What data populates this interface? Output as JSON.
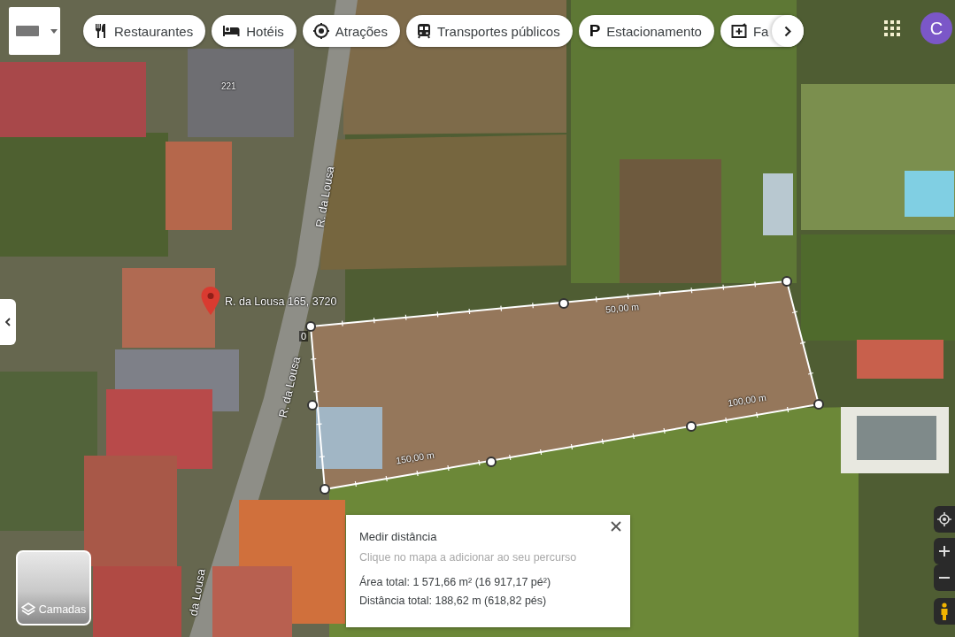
{
  "category_chips": [
    {
      "kind": "restaurants",
      "label": "Restaurantes"
    },
    {
      "kind": "hotels",
      "label": "Hotéis"
    },
    {
      "kind": "attractions",
      "label": "Atrações"
    },
    {
      "kind": "transit",
      "label": "Transportes públicos"
    },
    {
      "kind": "parking",
      "label": "Estacionamento",
      "glyph": "P"
    },
    {
      "kind": "pharmacy",
      "label": "Fa"
    }
  ],
  "account": {
    "initial": "C"
  },
  "map": {
    "street_labels": [
      "R. da Lousa",
      "R. da Lousa",
      "da Lousa"
    ],
    "house_numbers": [
      "221"
    ],
    "pin": {
      "label": "R. da Lousa 165, 3720"
    },
    "measurement": {
      "start_label": "0",
      "segment_labels": [
        "50,00 m",
        "100,00 m",
        "150,00 m"
      ]
    }
  },
  "layers_button": {
    "label": "Camadas"
  },
  "measure_panel": {
    "title": "Medir distância",
    "hint": "Clique no mapa a adicionar ao seu percurso",
    "area": "Área total: 1 571,66 m² (16 917,17 pé²)",
    "distance": "Distância total: 188,62 m (618,82 pés)"
  }
}
